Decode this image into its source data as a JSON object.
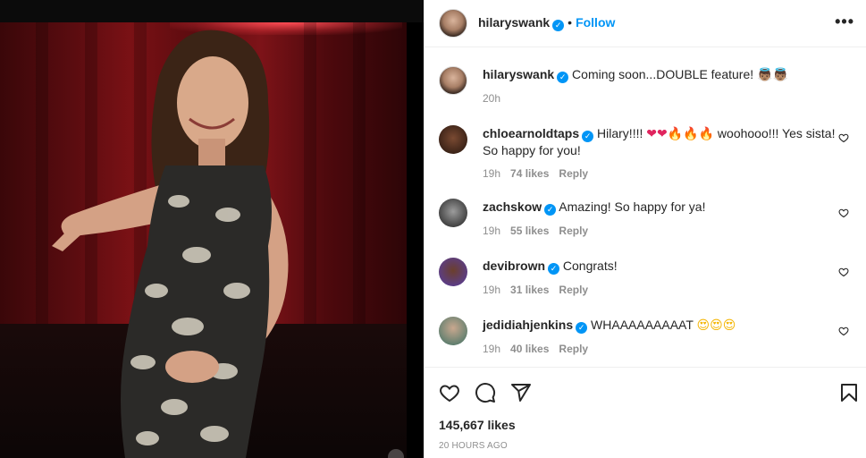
{
  "post": {
    "author": "hilaryswank",
    "follow_label": "Follow",
    "separator": "•",
    "more_label": "•••"
  },
  "caption": {
    "username": "hilaryswank",
    "text": "Coming soon...DOUBLE feature!",
    "emoji": "👼🏽👼🏽",
    "time": "20h"
  },
  "comments": [
    {
      "username": "chloearnoldtaps",
      "text_before": "Hilary!!!!",
      "emoji_hearts": "❤❤",
      "emoji_fire": "🔥🔥🔥",
      "text_after": "woohooo!!! Yes sista! So happy for you!",
      "time": "19h",
      "likes": "74 likes",
      "reply": "Reply"
    },
    {
      "username": "zachskow",
      "text": "Amazing! So happy for ya!",
      "time": "19h",
      "likes": "55 likes",
      "reply": "Reply"
    },
    {
      "username": "devibrown",
      "text": "Congrats!",
      "time": "19h",
      "likes": "31 likes",
      "reply": "Reply"
    },
    {
      "username": "jedidiahjenkins",
      "text": "WHAAAAAAAAAT",
      "emoji": "😍😍😍",
      "time": "19h",
      "likes": "40 likes",
      "reply": "Reply"
    }
  ],
  "stats": {
    "likes": "145,667 likes",
    "posted": "20 HOURS AGO"
  },
  "icons": {
    "verified": "verified-badge-icon",
    "like": "heart-icon",
    "comment": "comment-icon",
    "share": "share-icon",
    "save": "bookmark-icon",
    "more": "more-options-icon"
  },
  "colors": {
    "accent": "#0095f6",
    "muted": "#8e8e8e",
    "text": "#262626"
  }
}
